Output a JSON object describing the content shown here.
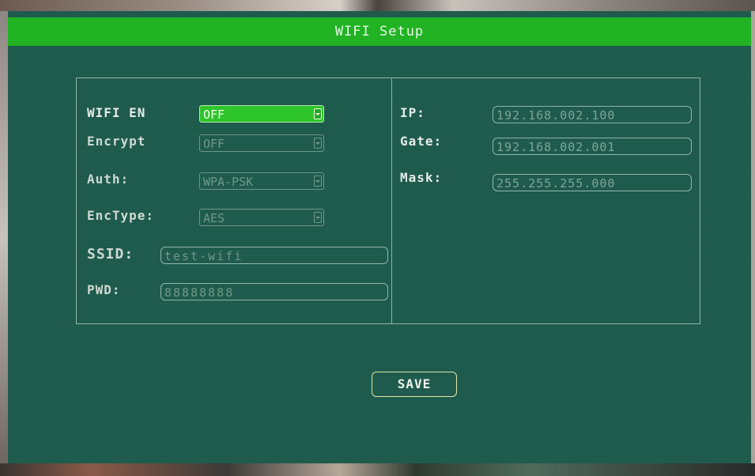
{
  "window": {
    "title": "WIFI Setup"
  },
  "left": {
    "wifi_en": {
      "label": "WIFI EN",
      "value": "OFF"
    },
    "encrypt": {
      "label": "Encrypt",
      "value": "OFF"
    },
    "auth": {
      "label": "Auth:",
      "value": "WPA-PSK"
    },
    "enctype": {
      "label": "EncType:",
      "value": "AES"
    },
    "ssid": {
      "label": "SSID:",
      "value": "test-wifi"
    },
    "pwd": {
      "label": "PWD:",
      "value": "88888888"
    }
  },
  "right": {
    "ip": {
      "label": "IP:",
      "value": "192.168.002.100"
    },
    "gate": {
      "label": "Gate:",
      "value": "192.168.002.001"
    },
    "mask": {
      "label": "Mask:",
      "value": "255.255.255.000"
    }
  },
  "buttons": {
    "save": "SAVE"
  },
  "colors": {
    "title_bar": "#21b323",
    "background": "#1d5a4c",
    "active_field": "#2ec52a"
  },
  "icons": {
    "dropdown": "chevron-down-icon"
  }
}
